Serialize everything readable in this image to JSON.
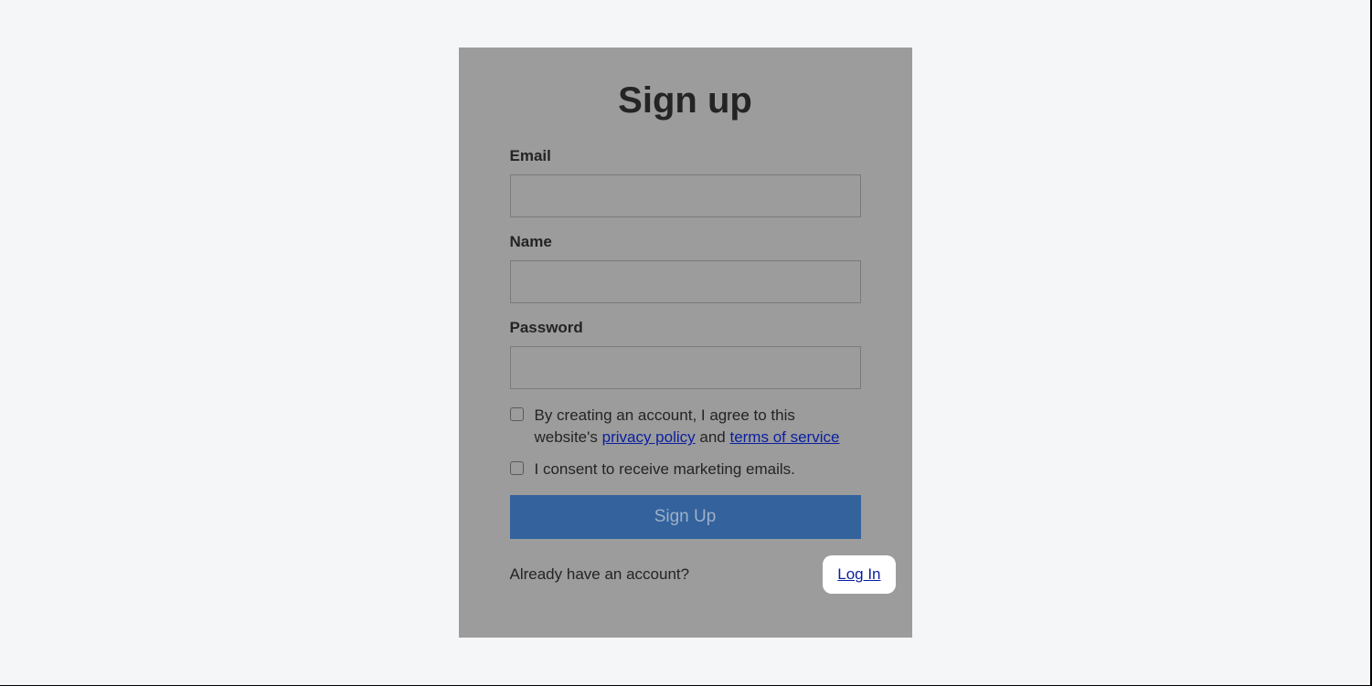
{
  "heading": "Sign up",
  "fields": {
    "email": {
      "label": "Email",
      "value": ""
    },
    "name": {
      "label": "Name",
      "value": ""
    },
    "password": {
      "label": "Password",
      "value": ""
    }
  },
  "terms": {
    "text_prefix": "By creating an account, I agree to this website's ",
    "privacy_link": "privacy policy",
    "middle": " and ",
    "tos_link": "terms of service"
  },
  "marketing_text": "I consent to receive marketing emails.",
  "signup_button": "Sign Up",
  "footer": {
    "text": "Already have an account?",
    "login": "Log In"
  }
}
